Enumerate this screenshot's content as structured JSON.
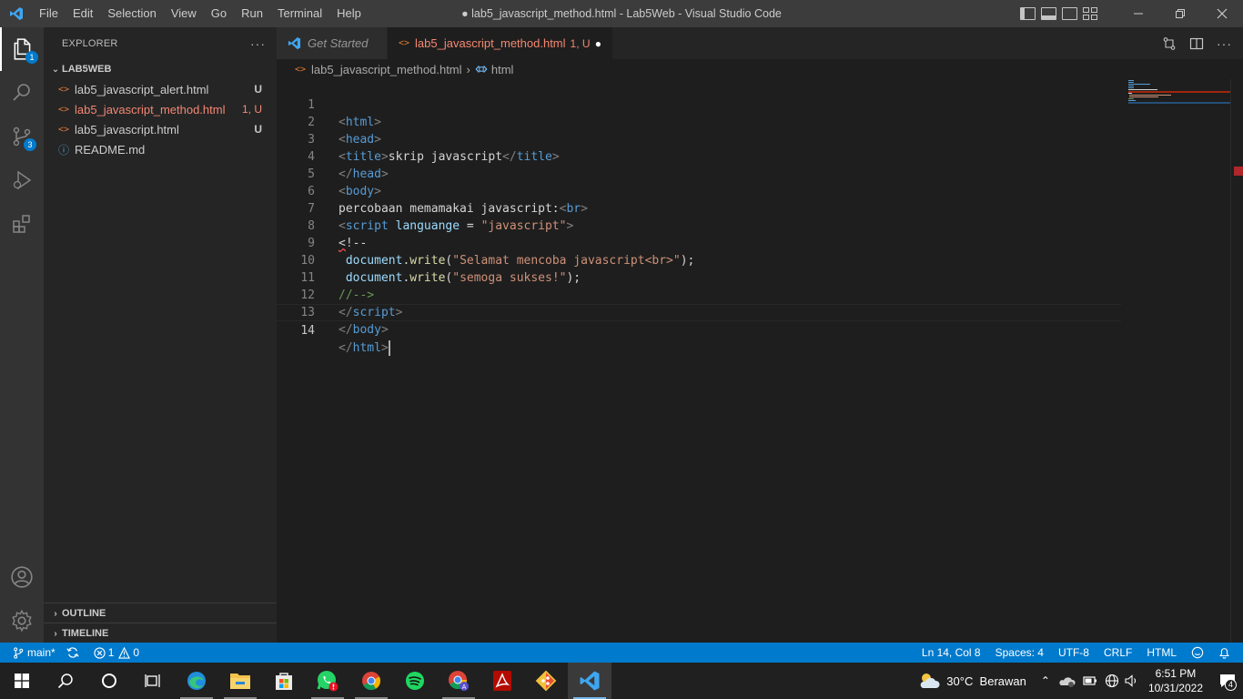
{
  "titlebar": {
    "menu": [
      "File",
      "Edit",
      "Selection",
      "View",
      "Go",
      "Run",
      "Terminal",
      "Help"
    ],
    "window_title": "● lab5_javascript_method.html - Lab5Web - Visual Studio Code"
  },
  "activitybar": {
    "explorer_badge": "1",
    "scm_badge": "3"
  },
  "sidebar": {
    "header": "EXPLORER",
    "more": "···",
    "folder": "LAB5WEB",
    "files": [
      {
        "icon": "<>",
        "name": "lab5_javascript_alert.html",
        "status": "U"
      },
      {
        "icon": "<>",
        "name": "lab5_javascript_method.html",
        "status": "1, U"
      },
      {
        "icon": "<>",
        "name": "lab5_javascript.html",
        "status": "U"
      },
      {
        "icon": "ⓘ",
        "name": "README.md",
        "status": ""
      }
    ],
    "outline": "OUTLINE",
    "timeline": "TIMELINE"
  },
  "tabs": [
    {
      "label": "Get Started"
    },
    {
      "label": "lab5_javascript_method.html",
      "status": "1, U",
      "dirty": "●"
    }
  ],
  "breadcrumb": {
    "file": "lab5_javascript_method.html",
    "separator": "›",
    "symbol": "html"
  },
  "editor": {
    "line_numbers": [
      "1",
      "2",
      "3",
      "4",
      "5",
      "6",
      "7",
      "8",
      "9",
      "10",
      "11",
      "12",
      "13",
      "14"
    ],
    "current_line": 14
  },
  "statusbar": {
    "branch": "main*",
    "errors": "1",
    "warnings": "0",
    "position": "Ln 14, Col 8",
    "spaces": "Spaces: 4",
    "encoding": "UTF-8",
    "eol": "CRLF",
    "language": "HTML"
  },
  "taskbar": {
    "weather": "30°C  Berawan",
    "time": "6:51 PM",
    "date": "10/31/2022",
    "notifications": "4"
  },
  "colors": {
    "accent": "#007acc",
    "modified": "#f48771"
  }
}
